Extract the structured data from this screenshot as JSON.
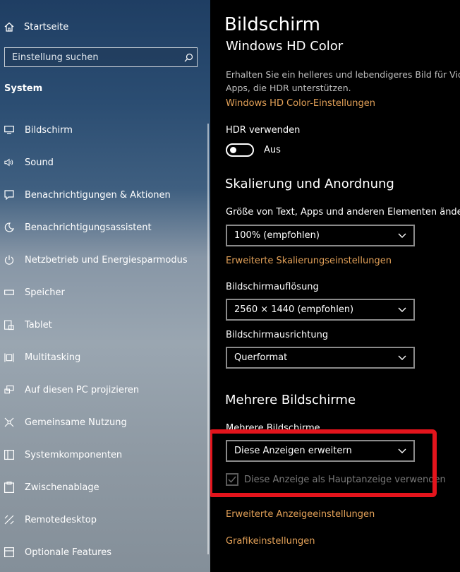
{
  "sidebar": {
    "home_label": "Startseite",
    "search_placeholder": "Einstellung suchen",
    "section": "System",
    "items": [
      {
        "label": "Bildschirm",
        "icon": "monitor-icon"
      },
      {
        "label": "Sound",
        "icon": "speaker-icon"
      },
      {
        "label": "Benachrichtigungen & Aktionen",
        "icon": "notification-icon"
      },
      {
        "label": "Benachrichtigungsassistent",
        "icon": "moon-icon"
      },
      {
        "label": "Netzbetrieb und Energiesparmodus",
        "icon": "power-icon"
      },
      {
        "label": "Speicher",
        "icon": "storage-icon"
      },
      {
        "label": "Tablet",
        "icon": "tablet-icon"
      },
      {
        "label": "Multitasking",
        "icon": "multitasking-icon"
      },
      {
        "label": "Auf diesen PC projizieren",
        "icon": "project-icon"
      },
      {
        "label": "Gemeinsame Nutzung",
        "icon": "share-icon"
      },
      {
        "label": "Systemkomponenten",
        "icon": "components-icon"
      },
      {
        "label": "Zwischenablage",
        "icon": "clipboard-icon"
      },
      {
        "label": "Remotedesktop",
        "icon": "remote-icon"
      },
      {
        "label": "Optionale Features",
        "icon": "features-icon"
      }
    ]
  },
  "main": {
    "title": "Bildschirm",
    "hdr_title": "Windows HD Color",
    "hdr_desc_line1": "Erhalten Sie ein helleres und lebendigeres Bild für Video",
    "hdr_desc_line2": "Apps, die HDR unterstützen.",
    "hdr_link": "Windows HD Color-Einstellungen",
    "hdr_toggle_label": "HDR verwenden",
    "hdr_toggle_state": "Aus",
    "scaling_heading": "Skalierung und Anordnung",
    "scaling_label": "Größe von Text, Apps und anderen Elementen ändern",
    "scaling_value": "100% (empfohlen)",
    "scaling_link": "Erweiterte Skalierungseinstellungen",
    "resolution_label": "Bildschirmauflösung",
    "resolution_value": "2560 × 1440 (empfohlen)",
    "orientation_label": "Bildschirmausrichtung",
    "orientation_value": "Querformat",
    "multi_heading": "Mehrere Bildschirme",
    "multi_label": "Mehrere Bildschirme",
    "multi_value": "Diese Anzeigen erweitern",
    "main_display_checkbox": "Diese Anzeige als Hauptanzeige verwenden",
    "advanced_display_link": "Erweiterte Anzeigeeinstellungen",
    "graphics_link": "Grafikeinstellungen"
  },
  "colors": {
    "accent_link": "#e3a158",
    "highlight": "#e3141c"
  }
}
